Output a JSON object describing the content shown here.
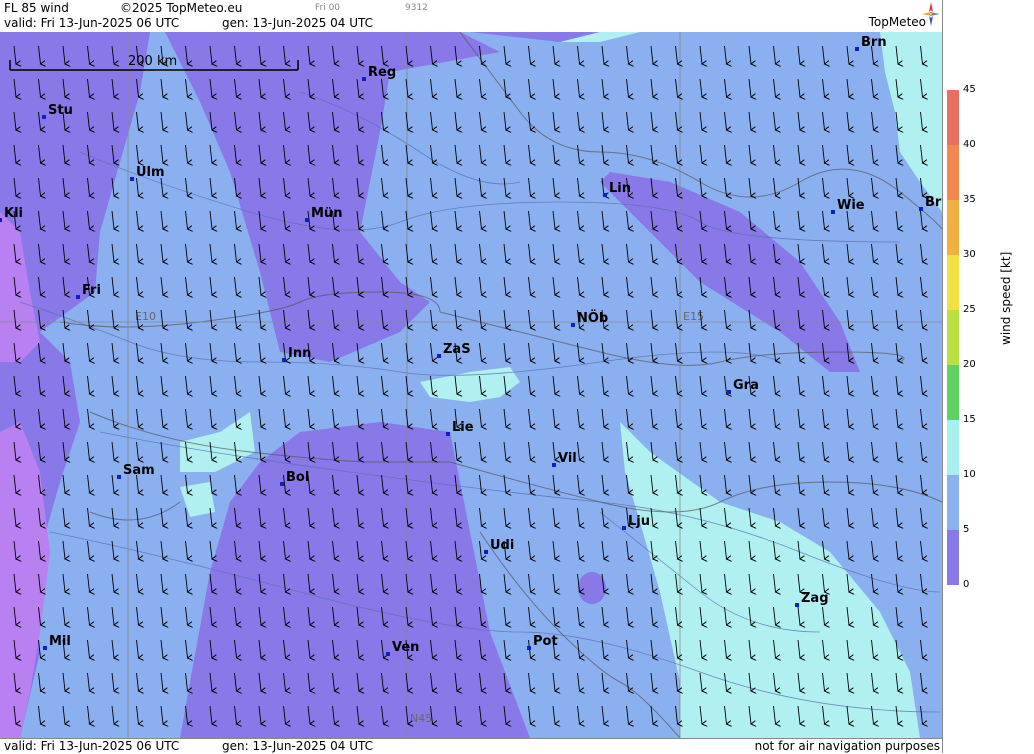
{
  "header": {
    "product": "FL 85 wind",
    "copyright": "©2025 TopMeteo.eu",
    "frame": "Fri 00",
    "code": "9312",
    "valid": "valid:  Fri  13-Jun-2025  06 UTC",
    "gen": "gen: 13-Jun-2025 04 UTC",
    "logo": "TopMeteo"
  },
  "scale": {
    "label": "200 km"
  },
  "cities": [
    {
      "label": "Stu"
    },
    {
      "label": "Reg"
    },
    {
      "label": "Brn"
    },
    {
      "label": "Ulm"
    },
    {
      "label": "Mün"
    },
    {
      "label": "Lin"
    },
    {
      "label": "Wie"
    },
    {
      "label": "Br"
    },
    {
      "label": "Kli"
    },
    {
      "label": "Fri"
    },
    {
      "label": "NÖb"
    },
    {
      "label": "Inn"
    },
    {
      "label": "ZaS"
    },
    {
      "label": "Gra"
    },
    {
      "label": "Lie"
    },
    {
      "label": "Vil"
    },
    {
      "label": "Sam"
    },
    {
      "label": "Bol"
    },
    {
      "label": "Lju"
    },
    {
      "label": "Udi"
    },
    {
      "label": "Zag"
    },
    {
      "label": "Mil"
    },
    {
      "label": "Ven"
    },
    {
      "label": "Pot"
    }
  ],
  "grid": {
    "e10": "E10",
    "e15": "E15",
    "n45": "N45"
  },
  "legend": {
    "unit": "wind  speed  [kt]",
    "ticks": [
      "45",
      "40",
      "35",
      "30",
      "25",
      "20",
      "15",
      "10",
      "5",
      "0"
    ],
    "colors": [
      "#e87060",
      "#f08850",
      "#f0b040",
      "#f0e040",
      "#b8e040",
      "#60d060",
      "#a8f0f0",
      "#8ab0f0",
      "#8878e8",
      "#c080f0"
    ]
  },
  "footer": {
    "valid": "valid:  Fri  13-Jun-2025  06 UTC",
    "gen": "gen: 13-Jun-2025 04 UTC",
    "note": "not for air navigation purposes"
  },
  "colors": {
    "speed_5_10": "#8878e8",
    "speed_10_15": "#8ab0f0",
    "speed_15_20": "#b0f0f0",
    "speed_0_5": "#b880f0"
  }
}
